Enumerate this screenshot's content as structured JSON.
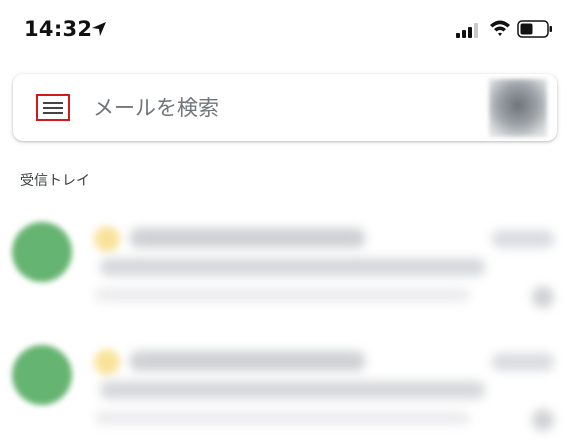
{
  "status_bar": {
    "time": "14:32",
    "icons": [
      "location-arrow-icon",
      "cellular-signal-icon",
      "wifi-icon",
      "battery-icon"
    ]
  },
  "search": {
    "placeholder": "メールを検索",
    "menu_icon": "hamburger-menu-icon"
  },
  "section": {
    "label": "受信トレイ"
  },
  "emails": [
    {
      "avatar_color": "#66b471",
      "star_color": "#f7dc83"
    },
    {
      "avatar_color": "#66b471",
      "star_color": "#f7dc83"
    }
  ],
  "colors": {
    "highlight_border": "#d21a1a",
    "avatar_green": "#66b471"
  }
}
